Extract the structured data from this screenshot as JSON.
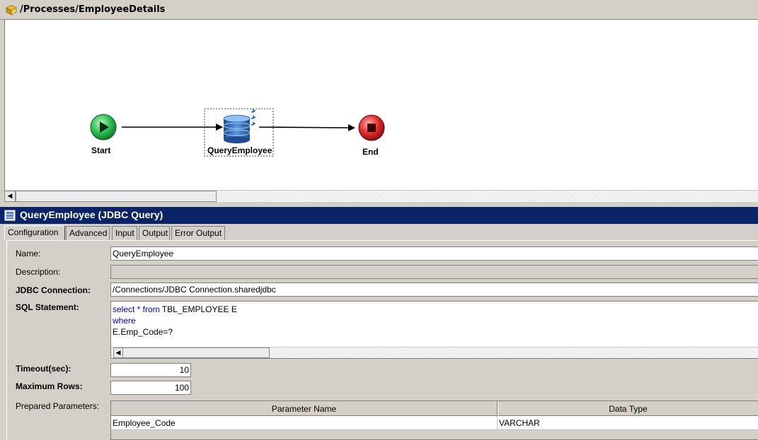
{
  "process": {
    "path": "/Processes/EmployeeDetails",
    "icon": "process-folder-icon"
  },
  "diagram": {
    "nodes": {
      "start": {
        "label": "Start",
        "icon": "play-icon",
        "color": "#2bbf4f"
      },
      "query": {
        "label": "QueryEmployee",
        "icon": "database-icon",
        "color": "#2d64b0"
      },
      "end": {
        "label": "End",
        "icon": "stop-icon",
        "color": "#e0282a"
      }
    }
  },
  "panel": {
    "title": "QueryEmployee (JDBC Query)",
    "header_color": "#0a246a",
    "icon": "jdbc-query-icon"
  },
  "tabs": [
    {
      "label": "Configuration",
      "active": true
    },
    {
      "label": "Advanced",
      "active": false
    },
    {
      "label": "Input",
      "active": false
    },
    {
      "label": "Output",
      "active": false
    },
    {
      "label": "Error Output",
      "active": false
    }
  ],
  "form": {
    "name": {
      "label": "Name:",
      "value": "QueryEmployee"
    },
    "description": {
      "label": "Description:",
      "value": ""
    },
    "jdbc_connection": {
      "label": "JDBC Connection:",
      "value": "/Connections/JDBC Connection.sharedjdbc"
    },
    "sql_statement": {
      "label": "SQL Statement:",
      "line1_kw": "select * from",
      "line1_rest": " TBL_EMPLOYEE E",
      "line2_kw": "where",
      "line3": "E.Emp_Code=?"
    },
    "timeout": {
      "label": "Timeout(sec):",
      "value": "10"
    },
    "max_rows": {
      "label": "Maximum Rows:",
      "value": "100"
    },
    "prepared_parameters": {
      "label": "Prepared Parameters:",
      "columns": [
        "Parameter Name",
        "Data Type"
      ],
      "rows": [
        {
          "name": "Employee_Code",
          "type": "VARCHAR"
        }
      ]
    }
  }
}
